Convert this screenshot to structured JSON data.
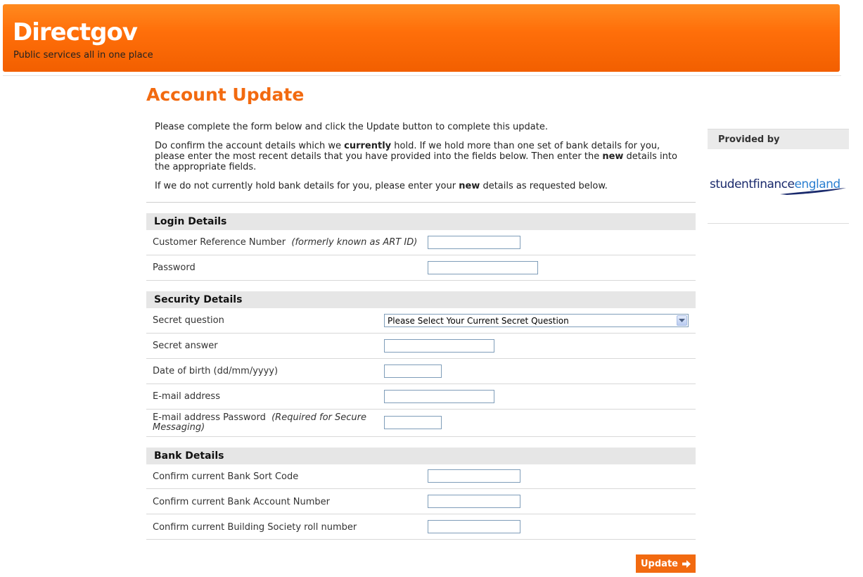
{
  "header": {
    "logo_text": "Directgov",
    "tagline": "Public services all in one place"
  },
  "page": {
    "title": "Account Update"
  },
  "intro": {
    "p1": "Please complete the form below and click the Update button to complete this update.",
    "p2_a": "Do confirm the account details which we ",
    "p2_b": "currently",
    "p2_c": " hold.  If we hold more than one set of bank details for you, please enter the most recent details that you have provided into the fields below.  Then enter the ",
    "p2_d": "new",
    "p2_e": " details into the appropriate fields.",
    "p3_a": "If we do not currently hold bank details for you, please enter your ",
    "p3_b": "new",
    "p3_c": " details as requested below."
  },
  "login": {
    "heading": "Login Details",
    "crn_label": "Customer Reference Number",
    "crn_note": "(formerly known as ART ID)",
    "crn_value": "",
    "password_label": "Password",
    "password_value": ""
  },
  "security": {
    "heading": "Security Details",
    "question_label": "Secret question",
    "question_selected": "Please Select Your Current Secret Question",
    "answer_label": "Secret answer",
    "answer_value": "",
    "dob_label": "Date of birth  (dd/mm/yyyy)",
    "dob_value": "",
    "email_label": "E-mail address",
    "email_value": "",
    "email_pw_label": "E-mail address Password",
    "email_pw_note": "(Required for Secure Messaging)",
    "email_pw_value": ""
  },
  "bank": {
    "heading": "Bank Details",
    "sort_label": "Confirm current Bank Sort Code",
    "sort_value": "",
    "account_label": "Confirm current Bank Account Number",
    "account_value": "",
    "roll_label": "Confirm current Building Society roll number",
    "roll_value": ""
  },
  "sidebar": {
    "provided_by": "Provided by",
    "logo_part1": "studentfinance",
    "logo_part2": "england"
  },
  "actions": {
    "update_label": "Update"
  },
  "colors": {
    "brand_orange": "#f26a10",
    "section_bg": "#e6e6e6"
  }
}
